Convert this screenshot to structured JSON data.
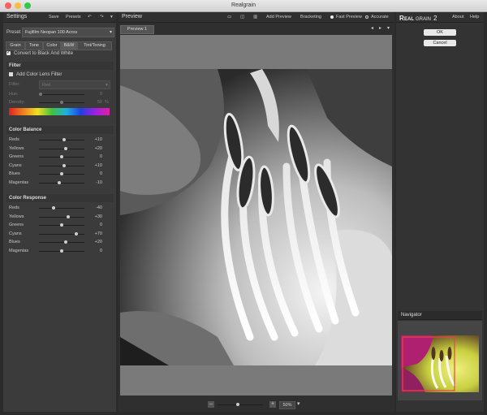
{
  "window": {
    "title": "Realgrain"
  },
  "settings": {
    "title": "Settings",
    "save": "Save",
    "presets": "Presets",
    "preset_label": "Preset",
    "preset_value": "Fujifilm Neopan 100 Acros",
    "tabs": [
      "Grain",
      "Tone",
      "Color",
      "B&W",
      "Tint/Toning"
    ],
    "convert_bw": "Convert to Black And White",
    "filter": {
      "heading": "Filter",
      "add_lens": "Add Color Lens Filter",
      "filter_label": "Filter:",
      "filter_value": "Red",
      "hue_label": "Hue:",
      "hue_value": "0",
      "density_label": "Density:",
      "density_value": "50",
      "density_unit": "%"
    },
    "color_balance": {
      "heading": "Color Balance",
      "rows": [
        {
          "label": "Reds",
          "value": "+10",
          "level": 0.55
        },
        {
          "label": "Yellows",
          "value": "+20",
          "level": 0.6
        },
        {
          "label": "Greens",
          "value": "0",
          "level": 0.5
        },
        {
          "label": "Cyans",
          "value": "+10",
          "level": 0.55
        },
        {
          "label": "Blues",
          "value": "0",
          "level": 0.5
        },
        {
          "label": "Magentas",
          "value": "-10",
          "level": 0.45
        }
      ]
    },
    "color_response": {
      "heading": "Color Response",
      "rows": [
        {
          "label": "Reds",
          "value": "-40",
          "level": 0.3
        },
        {
          "label": "Yellows",
          "value": "+30",
          "level": 0.65
        },
        {
          "label": "Greens",
          "value": "0",
          "level": 0.5
        },
        {
          "label": "Cyans",
          "value": "+70",
          "level": 0.85
        },
        {
          "label": "Blues",
          "value": "+20",
          "level": 0.6
        },
        {
          "label": "Magentas",
          "value": "0",
          "level": 0.5
        }
      ]
    }
  },
  "preview": {
    "title": "Preview",
    "add_preview": "Add Preview",
    "bracketing": "Bracketing",
    "fast_preview": "Fast Preview",
    "accurate": "Accurate",
    "tab": "Preview 1",
    "zoom_minus": "–",
    "zoom_plus": "+",
    "zoom_value": "50%",
    "zoom_level": 0.45
  },
  "right": {
    "about": "About",
    "help": "Help",
    "ok": "OK",
    "cancel": "Cancel",
    "navigator": "Navigator"
  },
  "colors": {
    "titlebar_close": "#fc605c",
    "titlebar_min": "#fdbc40",
    "titlebar_max": "#34c84a",
    "accent": "#e84545"
  }
}
